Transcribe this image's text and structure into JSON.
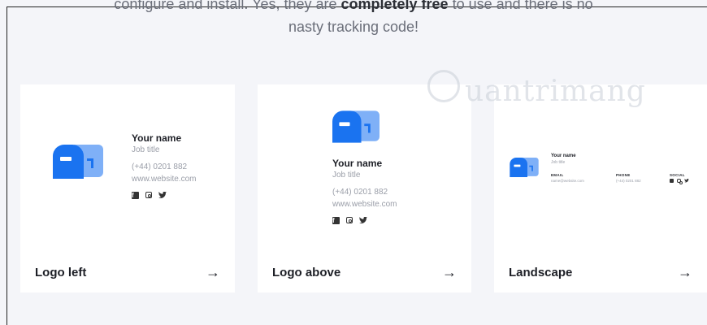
{
  "intro": {
    "line1_pre": "configure and install. Yes, they are ",
    "line1_bold": "completely free",
    "line1_post": " to use and there is no",
    "line2": "nasty tracking code!"
  },
  "cards": [
    {
      "title": "Logo left",
      "signature": {
        "name": "Your name",
        "job": "Job title",
        "phone": "(+44) 0201 882",
        "website": "www.website.com"
      }
    },
    {
      "title": "Logo above",
      "signature": {
        "name": "Your name",
        "job": "Job title",
        "phone": "(+44) 0201 882",
        "website": "www.website.com"
      }
    },
    {
      "title": "Landscape",
      "signature": {
        "name": "Your name",
        "job": "Job title",
        "email_label": "EMAIL",
        "email": "name@website.com",
        "phone_label": "PHONE",
        "phone": "(+44) 0201 882",
        "social_label": "SOCIAL"
      }
    }
  ],
  "arrow_glyph": "→",
  "watermark_text": "uantrimang",
  "colors": {
    "logo_dark": "#1a73f0",
    "logo_light": "#7fb0f7",
    "background": "#f4f5f9",
    "card": "#ffffff"
  },
  "icons": [
    "facebook-icon",
    "instagram-icon",
    "twitter-icon",
    "arrow-right-icon",
    "mailbox-logo-icon"
  ]
}
